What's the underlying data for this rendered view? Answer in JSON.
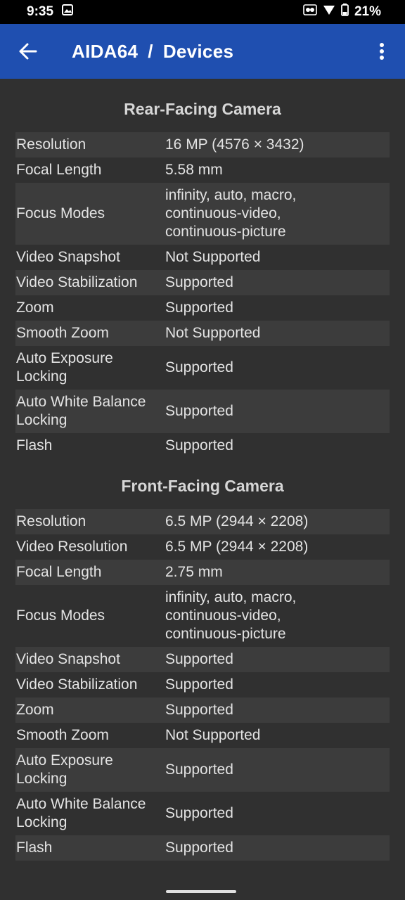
{
  "status": {
    "time": "9:35",
    "battery": "21%"
  },
  "header": {
    "app": "AIDA64",
    "separator": "/",
    "page": "Devices"
  },
  "rear": {
    "title": "Rear-Facing Camera",
    "rows": [
      {
        "label": "Resolution",
        "value": "16 MP (4576 × 3432)"
      },
      {
        "label": "Focal Length",
        "value": "5.58 mm"
      },
      {
        "label": "Focus Modes",
        "value": "infinity, auto, macro,\ncontinuous-video,\ncontinuous-picture"
      },
      {
        "label": "Video Snapshot",
        "value": "Not Supported"
      },
      {
        "label": "Video Stabilization",
        "value": "Supported"
      },
      {
        "label": "Zoom",
        "value": "Supported"
      },
      {
        "label": "Smooth Zoom",
        "value": "Not Supported"
      },
      {
        "label": "Auto Exposure\nLocking",
        "value": "Supported"
      },
      {
        "label": "Auto White Balance\nLocking",
        "value": "Supported"
      },
      {
        "label": "Flash",
        "value": "Supported"
      }
    ]
  },
  "front": {
    "title": "Front-Facing Camera",
    "rows": [
      {
        "label": "Resolution",
        "value": "6.5 MP (2944 × 2208)"
      },
      {
        "label": "Video Resolution",
        "value": "6.5 MP (2944 × 2208)"
      },
      {
        "label": "Focal Length",
        "value": "2.75 mm"
      },
      {
        "label": "Focus Modes",
        "value": "infinity, auto, macro,\ncontinuous-video,\ncontinuous-picture"
      },
      {
        "label": "Video Snapshot",
        "value": "Supported"
      },
      {
        "label": "Video Stabilization",
        "value": "Supported"
      },
      {
        "label": "Zoom",
        "value": "Supported"
      },
      {
        "label": "Smooth Zoom",
        "value": "Not Supported"
      },
      {
        "label": "Auto Exposure\nLocking",
        "value": "Supported"
      },
      {
        "label": "Auto White Balance\nLocking",
        "value": "Supported"
      },
      {
        "label": "Flash",
        "value": "Supported"
      }
    ]
  }
}
